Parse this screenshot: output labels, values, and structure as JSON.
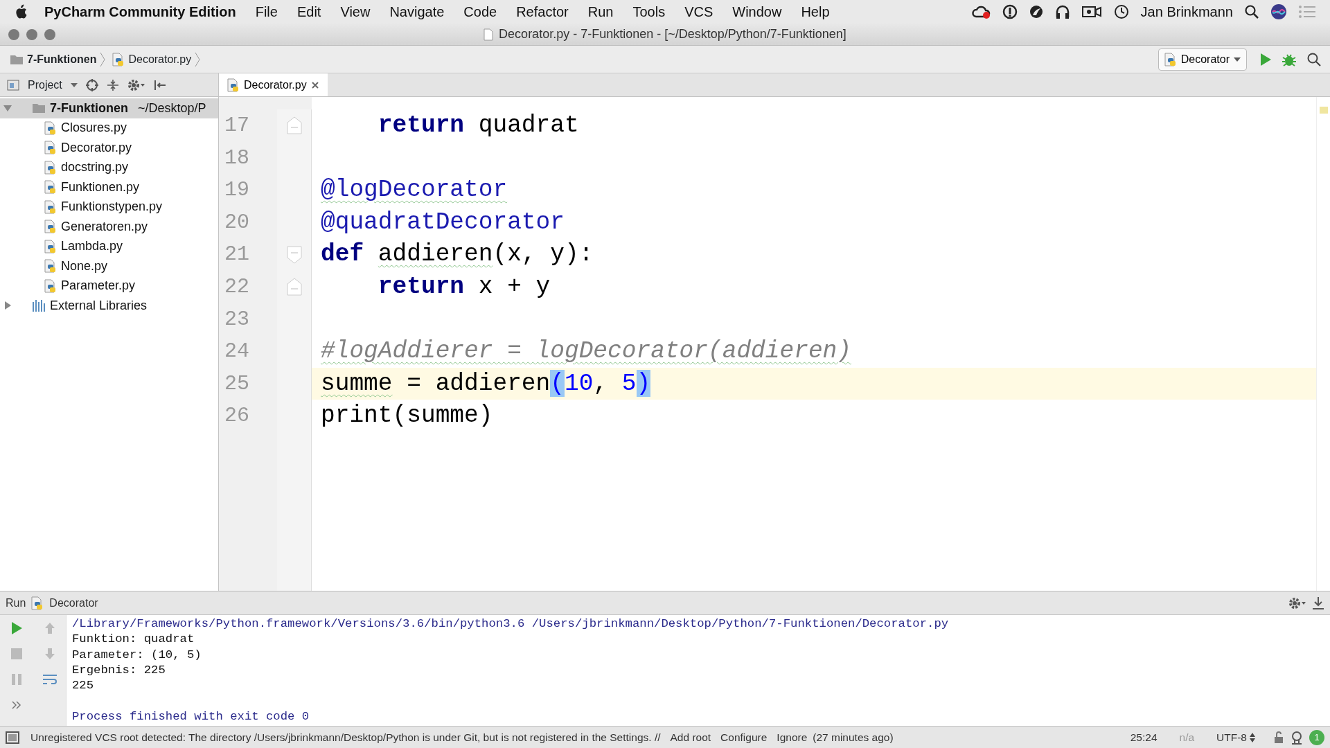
{
  "menubar": {
    "app_name": "PyCharm Community Edition",
    "items": [
      "File",
      "Edit",
      "View",
      "Navigate",
      "Code",
      "Refactor",
      "Run",
      "Tools",
      "VCS",
      "Window",
      "Help"
    ],
    "user_name": "Jan Brinkmann"
  },
  "window": {
    "title": "Decorator.py - 7-Funktionen - [~/Desktop/Python/7-Funktionen]"
  },
  "breadcrumbs": [
    {
      "label": "7-Funktionen",
      "kind": "folder"
    },
    {
      "label": "Decorator.py",
      "kind": "file"
    }
  ],
  "run_config": "Decorator",
  "project_panel": {
    "label": "Project",
    "tree": [
      {
        "name": "7-Funktionen",
        "path": "~/Desktop/P",
        "kind": "folder",
        "expanded": true,
        "selected": true,
        "children": [
          {
            "name": "Closures.py",
            "kind": "file",
            "selected": false
          },
          {
            "name": "Decorator.py",
            "kind": "file",
            "selected": false
          },
          {
            "name": "docstring.py",
            "kind": "file",
            "selected": false
          },
          {
            "name": "Funktionen.py",
            "kind": "file",
            "selected": false
          },
          {
            "name": "Funktionstypen.py",
            "kind": "file",
            "selected": false
          },
          {
            "name": "Generatoren.py",
            "kind": "file",
            "selected": false
          },
          {
            "name": "Lambda.py",
            "kind": "file",
            "selected": false
          },
          {
            "name": "None.py",
            "kind": "file",
            "selected": false
          },
          {
            "name": "Parameter.py",
            "kind": "file",
            "selected": false
          }
        ]
      },
      {
        "name": "External Libraries",
        "kind": "library",
        "expanded": false,
        "selected": false
      }
    ]
  },
  "editor_tabs": [
    {
      "label": "Decorator.py",
      "selected": true
    }
  ],
  "editor": {
    "lines": [
      {
        "number": "17",
        "current": false,
        "fold_end": true,
        "indented": true,
        "tokens": [
          {
            "kind": "keyword",
            "text": "return"
          },
          {
            "kind": "plain",
            "text": " quadrat"
          }
        ]
      },
      {
        "number": "18",
        "current": false
      },
      {
        "number": "19",
        "current": false,
        "tokens": [
          {
            "kind": "decorator",
            "text": "@logDecorator",
            "warning": true
          }
        ]
      },
      {
        "number": "20",
        "current": false,
        "tokens": [
          {
            "kind": "decorator",
            "text": "@quadratDecorator"
          }
        ]
      },
      {
        "number": "21",
        "current": false,
        "fold_start": true,
        "tokens": [
          {
            "kind": "keyword",
            "text": "def "
          },
          {
            "kind": "plain",
            "text": "addieren",
            "warning": true
          },
          {
            "kind": "plain",
            "text": "(x, y):"
          }
        ]
      },
      {
        "number": "22",
        "current": false,
        "fold_end": true,
        "indented": true,
        "tokens": [
          {
            "kind": "keyword",
            "text": "return"
          },
          {
            "kind": "plain",
            "text": " x + y"
          }
        ]
      },
      {
        "number": "23",
        "current": false
      },
      {
        "number": "24",
        "current": false,
        "tokens": [
          {
            "kind": "comment",
            "text": "#logAddierer = logDecorator(addieren)",
            "warning": true
          }
        ]
      },
      {
        "number": "25",
        "current": true,
        "tokens": [
          {
            "kind": "plain",
            "text": "summe",
            "warning": true
          },
          {
            "kind": "plain",
            "text": " = addieren"
          },
          {
            "kind": "brace",
            "text": "("
          },
          {
            "kind": "number",
            "text": "10"
          },
          {
            "kind": "plain",
            "text": ", "
          },
          {
            "kind": "number",
            "text": "5"
          },
          {
            "kind": "brace",
            "text": ")"
          }
        ]
      },
      {
        "number": "26",
        "current": false,
        "tokens": [
          {
            "kind": "plain",
            "text": "print(summe)"
          }
        ]
      }
    ]
  },
  "run_panel": {
    "label": "Run",
    "config": "Decorator",
    "output": [
      {
        "kind": "command",
        "text": "/Library/Frameworks/Python.framework/Versions/3.6/bin/python3.6 /Users/jbrinkmann/Desktop/Python/7-Funktionen/Decorator.py"
      },
      {
        "kind": "output",
        "text": "Funktion: quadrat"
      },
      {
        "kind": "output",
        "text": "Parameter: (10, 5)"
      },
      {
        "kind": "output",
        "text": "Ergebnis: 225"
      },
      {
        "kind": "output",
        "text": "225"
      },
      {
        "kind": "exit",
        "text": "Process finished with exit code 0"
      }
    ]
  },
  "status_bar": {
    "message": "Unregistered VCS root detected: The directory /Users/jbrinkmann/Desktop/Python is under Git, but is not registered in the Settings. //",
    "links": [
      "Add root",
      "Configure",
      "Ignore"
    ],
    "age": "(27 minutes ago)",
    "position": "25:24",
    "line_separator": "n/a",
    "encoding": "UTF-8",
    "notifications": "1"
  }
}
